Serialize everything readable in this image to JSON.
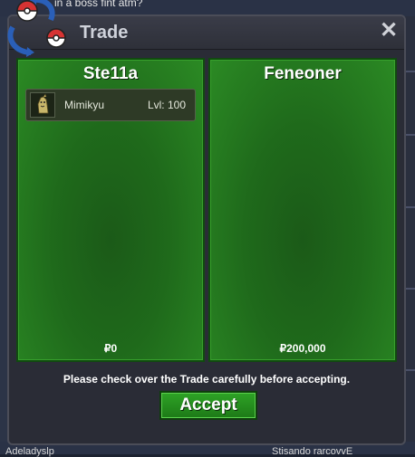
{
  "background": {
    "top_text": "in a boss fint atm?",
    "bottom_left_text": "Adeladyslp",
    "bottom_right_text": "Stisando rarcovvE"
  },
  "window": {
    "title": "Trade",
    "close_glyph": "✕",
    "logo_icon": "trade-pokeballs-icon"
  },
  "left_panel": {
    "player": "Ste11a",
    "items": [
      {
        "name": "Mimikyu",
        "level": "Lvl: 100",
        "icon": "mimikyu-sprite-icon"
      }
    ],
    "money": "₽0"
  },
  "right_panel": {
    "player": "Feneoner",
    "items": [],
    "money": "₽200,000"
  },
  "notice": "Please check over the Trade carefully before accepting.",
  "accept_label": "Accept",
  "colors": {
    "panel_green": "#1f6a1b",
    "button_green": "#2ea326",
    "window_bg": "#2a2c36",
    "pokeball_red": "#d63333",
    "arrow_blue": "#2a5fb8"
  }
}
